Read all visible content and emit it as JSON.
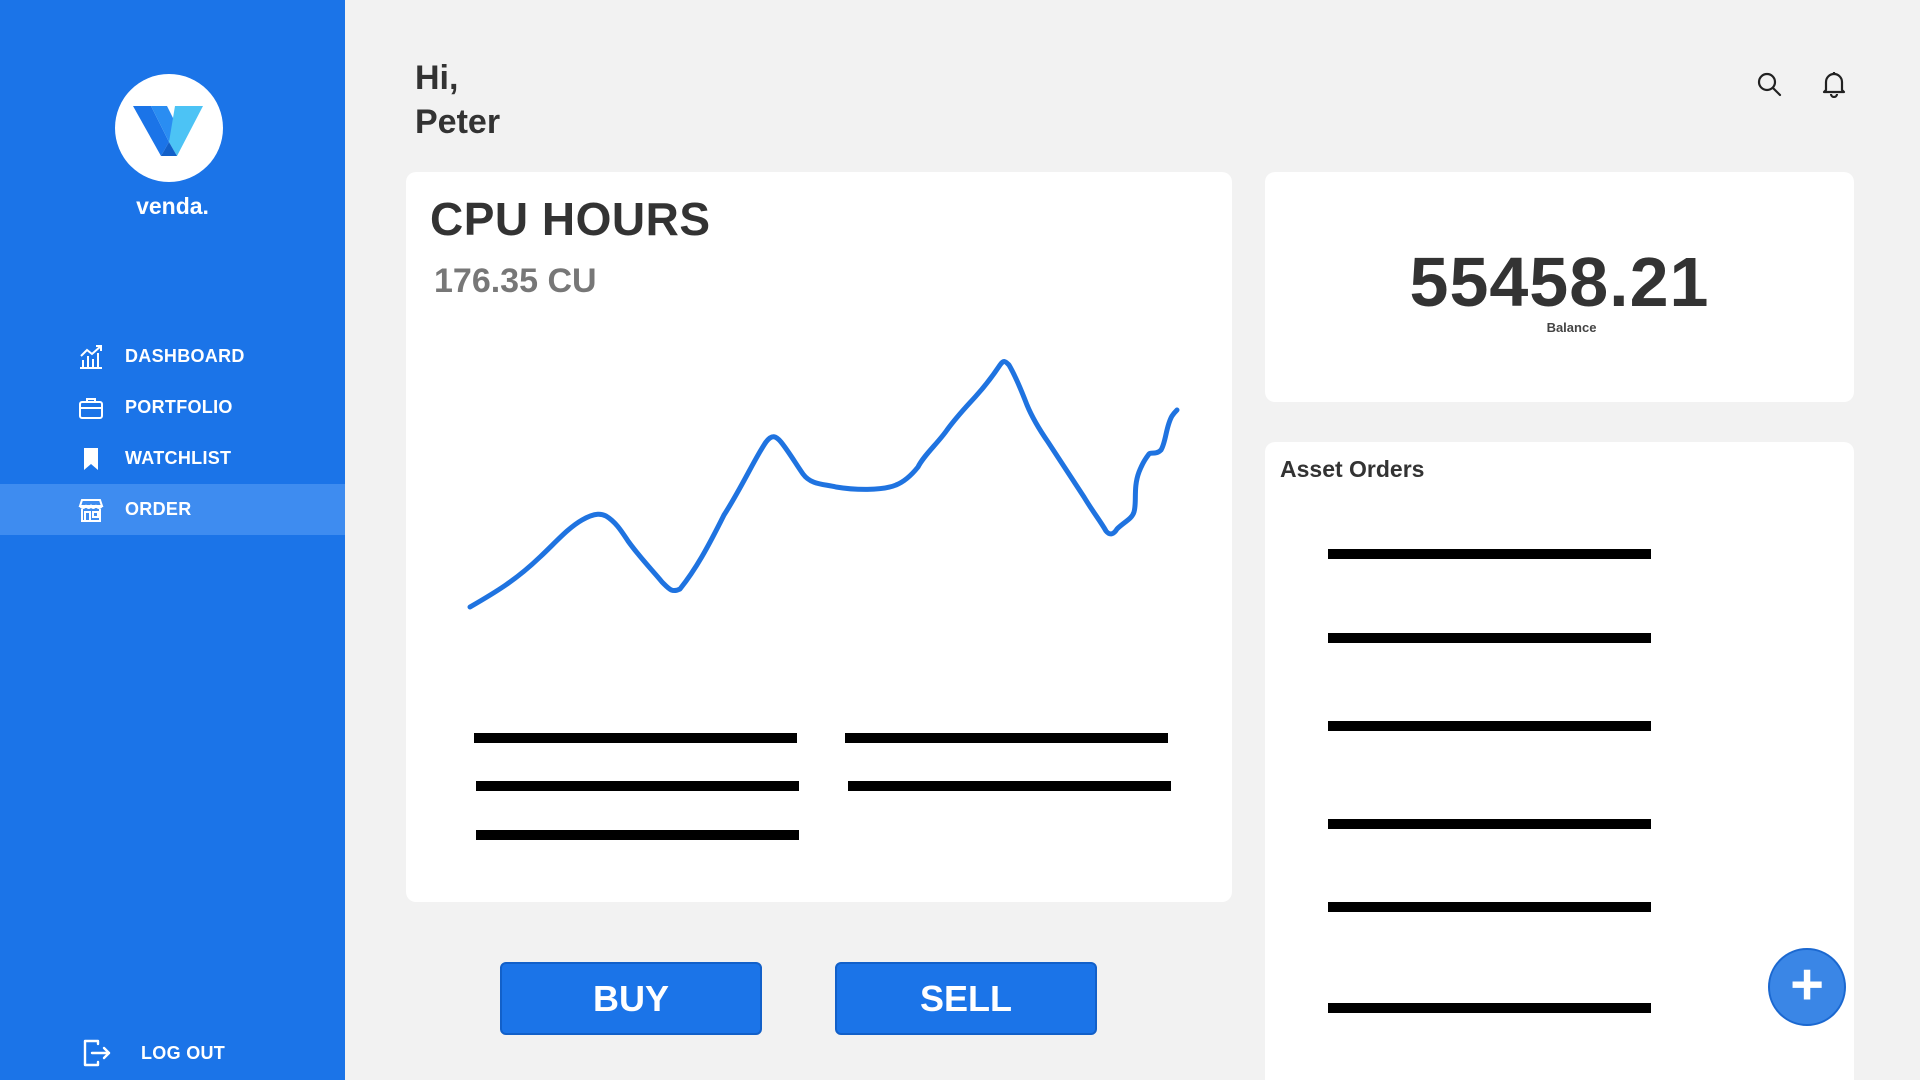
{
  "brand": {
    "name": "venda."
  },
  "nav": {
    "items": [
      {
        "label": "DASHBOARD",
        "icon": "chart-icon"
      },
      {
        "label": "PORTFOLIO",
        "icon": "briefcase-icon"
      },
      {
        "label": "WATCHLIST",
        "icon": "bookmark-icon"
      },
      {
        "label": "ORDER",
        "icon": "store-icon",
        "active": true
      }
    ],
    "logout_label": "LOG OUT"
  },
  "header": {
    "greeting_line1": "Hi,",
    "greeting_line2": "Peter"
  },
  "cpu_card": {
    "title": "CPU HOURS",
    "value": "176.35 CU"
  },
  "balance_card": {
    "value": "55458.21",
    "label": "Balance"
  },
  "orders_card": {
    "title": "Asset Orders"
  },
  "actions": {
    "buy_label": "BUY",
    "sell_label": "SELL",
    "add_label": "+"
  },
  "colors": {
    "primary": "#1b74e8",
    "active_nav": "#3e8cf0",
    "background": "#f2f2f2"
  }
}
